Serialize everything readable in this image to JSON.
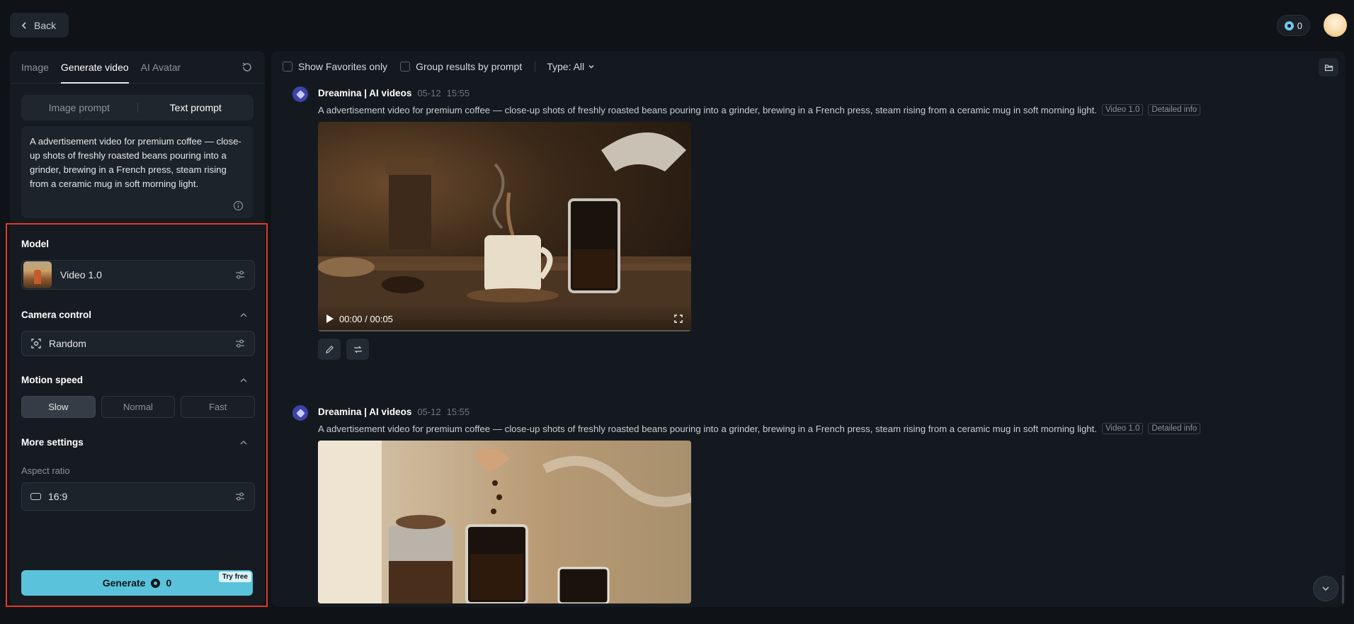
{
  "topbar": {
    "back_label": "Back",
    "credits": "0"
  },
  "left_panel": {
    "tabs": [
      {
        "label": "Image",
        "active": false
      },
      {
        "label": "Generate video",
        "active": true
      },
      {
        "label": "AI Avatar",
        "active": false
      }
    ],
    "prompt_modes": [
      {
        "label": "Image prompt",
        "active": false
      },
      {
        "label": "Text prompt",
        "active": true
      }
    ],
    "prompt_text": "A advertisement video for premium coffee — close-up shots of freshly roasted beans pouring into a grinder, brewing in a French press, steam rising from a ceramic mug in soft morning light.",
    "model": {
      "title": "Model",
      "value": "Video 1.0"
    },
    "camera_control": {
      "title": "Camera control",
      "value": "Random"
    },
    "motion_speed": {
      "title": "Motion speed",
      "options": [
        {
          "label": "Slow",
          "active": true
        },
        {
          "label": "Normal",
          "active": false
        },
        {
          "label": "Fast",
          "active": false
        }
      ]
    },
    "more_settings": {
      "title": "More settings",
      "aspect_label": "Aspect ratio",
      "aspect_value": "16:9"
    },
    "generate": {
      "label": "Generate",
      "cost": "0",
      "badge": "Try free"
    }
  },
  "main": {
    "filters": {
      "favorites": "Show Favorites only",
      "group": "Group results by prompt",
      "type": "Type: All"
    },
    "results": [
      {
        "source": "Dreamina | AI videos",
        "date": "05-12",
        "time": "15:55",
        "prompt": "A advertisement video for premium coffee — close-up shots of freshly roasted beans pouring into a grinder, brewing in a French press, steam rising from a ceramic mug in soft morning light.",
        "model_tag": "Video 1.0",
        "info_tag": "Detailed info",
        "time_display": "00:00 / 00:05",
        "progress": 0
      },
      {
        "source": "Dreamina | AI videos",
        "date": "05-12",
        "time": "15:55",
        "prompt": "A advertisement video for premium coffee — close-up shots of freshly roasted beans pouring into a grinder, brewing in a French press, steam rising from a ceramic mug in soft morning light.",
        "model_tag": "Video 1.0",
        "info_tag": "Detailed info"
      }
    ]
  },
  "colors": {
    "accent": "#5ac3db",
    "highlight": "#e0392b",
    "background": "#0f1318"
  }
}
